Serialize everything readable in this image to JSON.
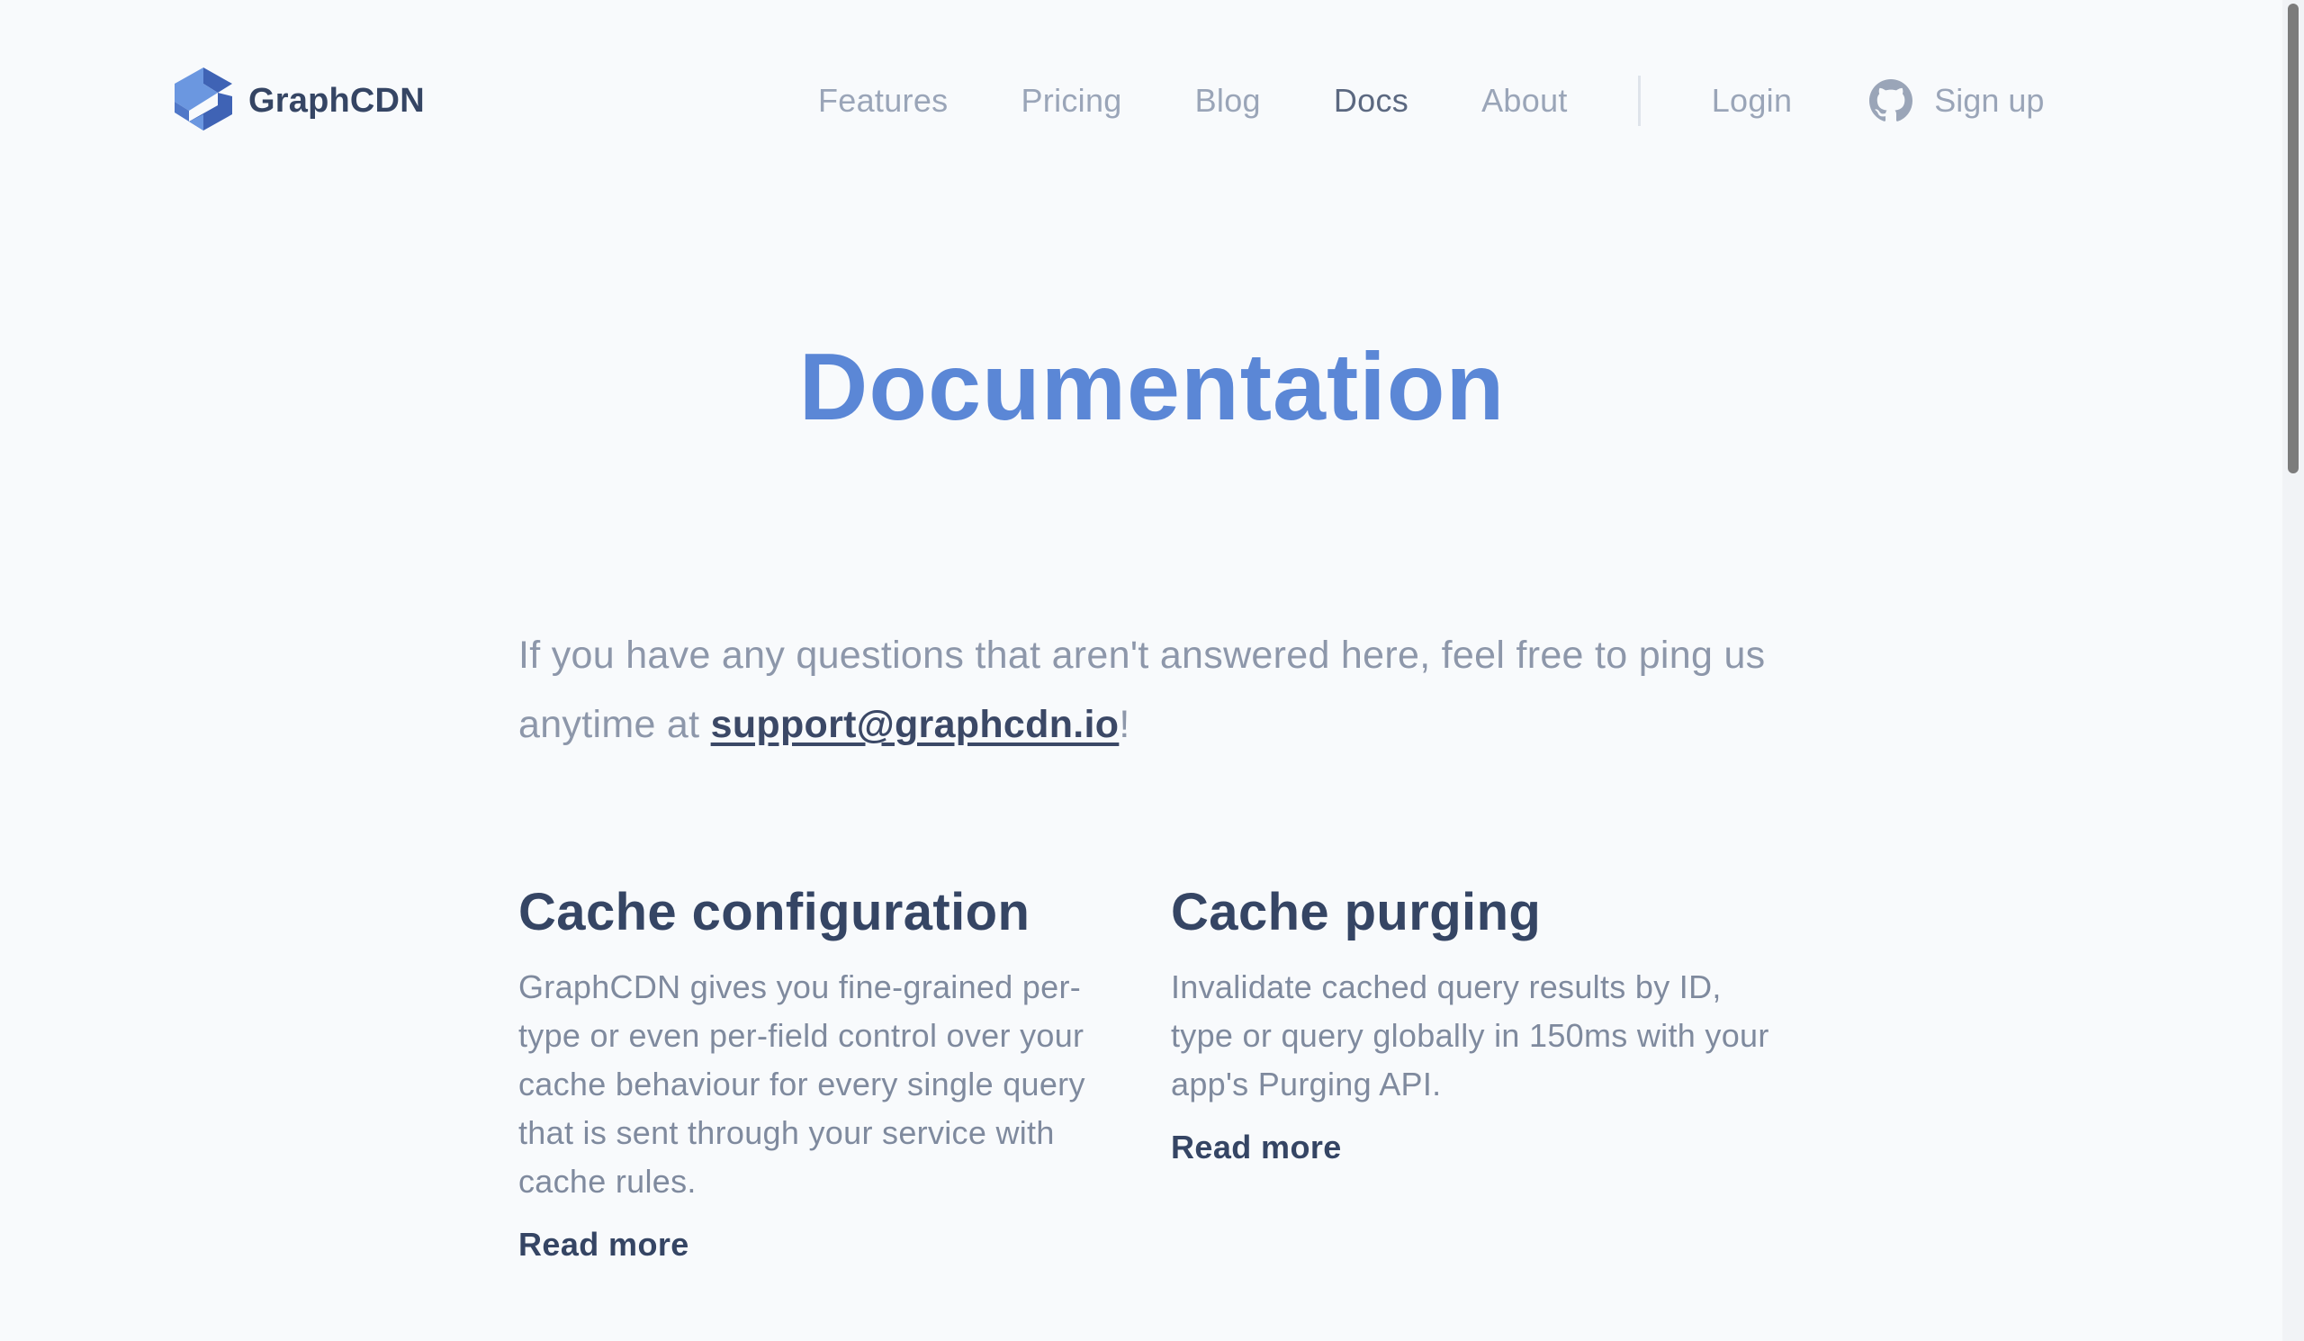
{
  "brand": {
    "name": "GraphCDN",
    "logo_icon": "graphcdn-logo-icon",
    "colors": {
      "logo_light": "#6b97e0",
      "logo_dark": "#3f63b5"
    }
  },
  "nav": {
    "items": [
      {
        "label": "Features",
        "active": false
      },
      {
        "label": "Pricing",
        "active": false
      },
      {
        "label": "Blog",
        "active": false
      },
      {
        "label": "Docs",
        "active": true
      },
      {
        "label": "About",
        "active": false
      }
    ],
    "login_label": "Login",
    "signup_label": "Sign up",
    "signup_icon": "github-icon"
  },
  "hero": {
    "title": "Documentation",
    "title_color": "#5b87d6"
  },
  "intro": {
    "text_before": "If you have any questions that aren't answered here, feel free to ping us anytime at ",
    "email": "support@graphcdn.io",
    "text_after": "!"
  },
  "cards": [
    {
      "title": "Cache configuration",
      "description": "GraphCDN gives you fine-grained per-type or even per-field control over your cache behaviour for every single query that is sent through your service with cache rules.",
      "link_label": "Read more"
    },
    {
      "title": "Cache purging",
      "description": "Invalidate cached query results by ID, type or query globally in 150ms with your app's Purging API.",
      "link_label": "Read more"
    }
  ]
}
